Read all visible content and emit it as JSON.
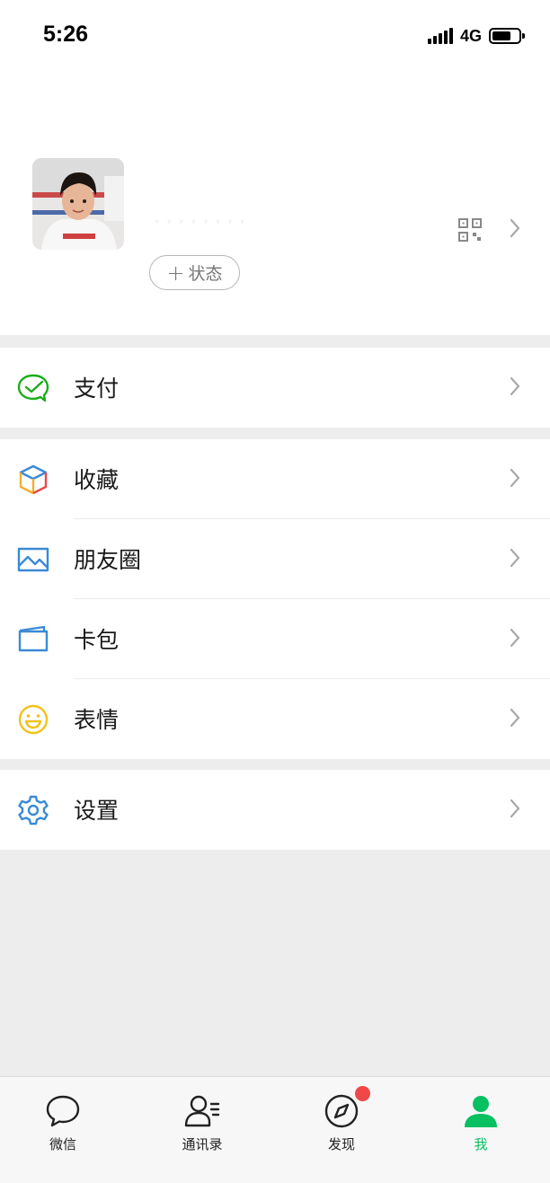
{
  "status_bar": {
    "time": "5:26",
    "network": "4G"
  },
  "profile": {
    "status_button_label": "状态",
    "status_button_plus": "+",
    "name_obscured": "········"
  },
  "menu": {
    "pay": {
      "label": "支付",
      "icon": "wallet-check-icon"
    },
    "favorites": {
      "label": "收藏",
      "icon": "cube-icon"
    },
    "moments": {
      "label": "朋友圈",
      "icon": "picture-icon"
    },
    "cards": {
      "label": "卡包",
      "icon": "card-icon"
    },
    "stickers": {
      "label": "表情",
      "icon": "smiley-icon"
    },
    "settings": {
      "label": "设置",
      "icon": "gear-icon"
    }
  },
  "tabbar": {
    "tabs": [
      {
        "label": "微信",
        "icon": "chat-bubble-icon",
        "active": false
      },
      {
        "label": "通讯录",
        "icon": "contacts-icon",
        "active": false
      },
      {
        "label": "发现",
        "icon": "compass-icon",
        "active": false,
        "has_badge": true
      },
      {
        "label": "我",
        "icon": "person-icon",
        "active": true
      }
    ]
  },
  "colors": {
    "accent": "#07c160",
    "badge": "#f04848",
    "background": "#ededed"
  }
}
